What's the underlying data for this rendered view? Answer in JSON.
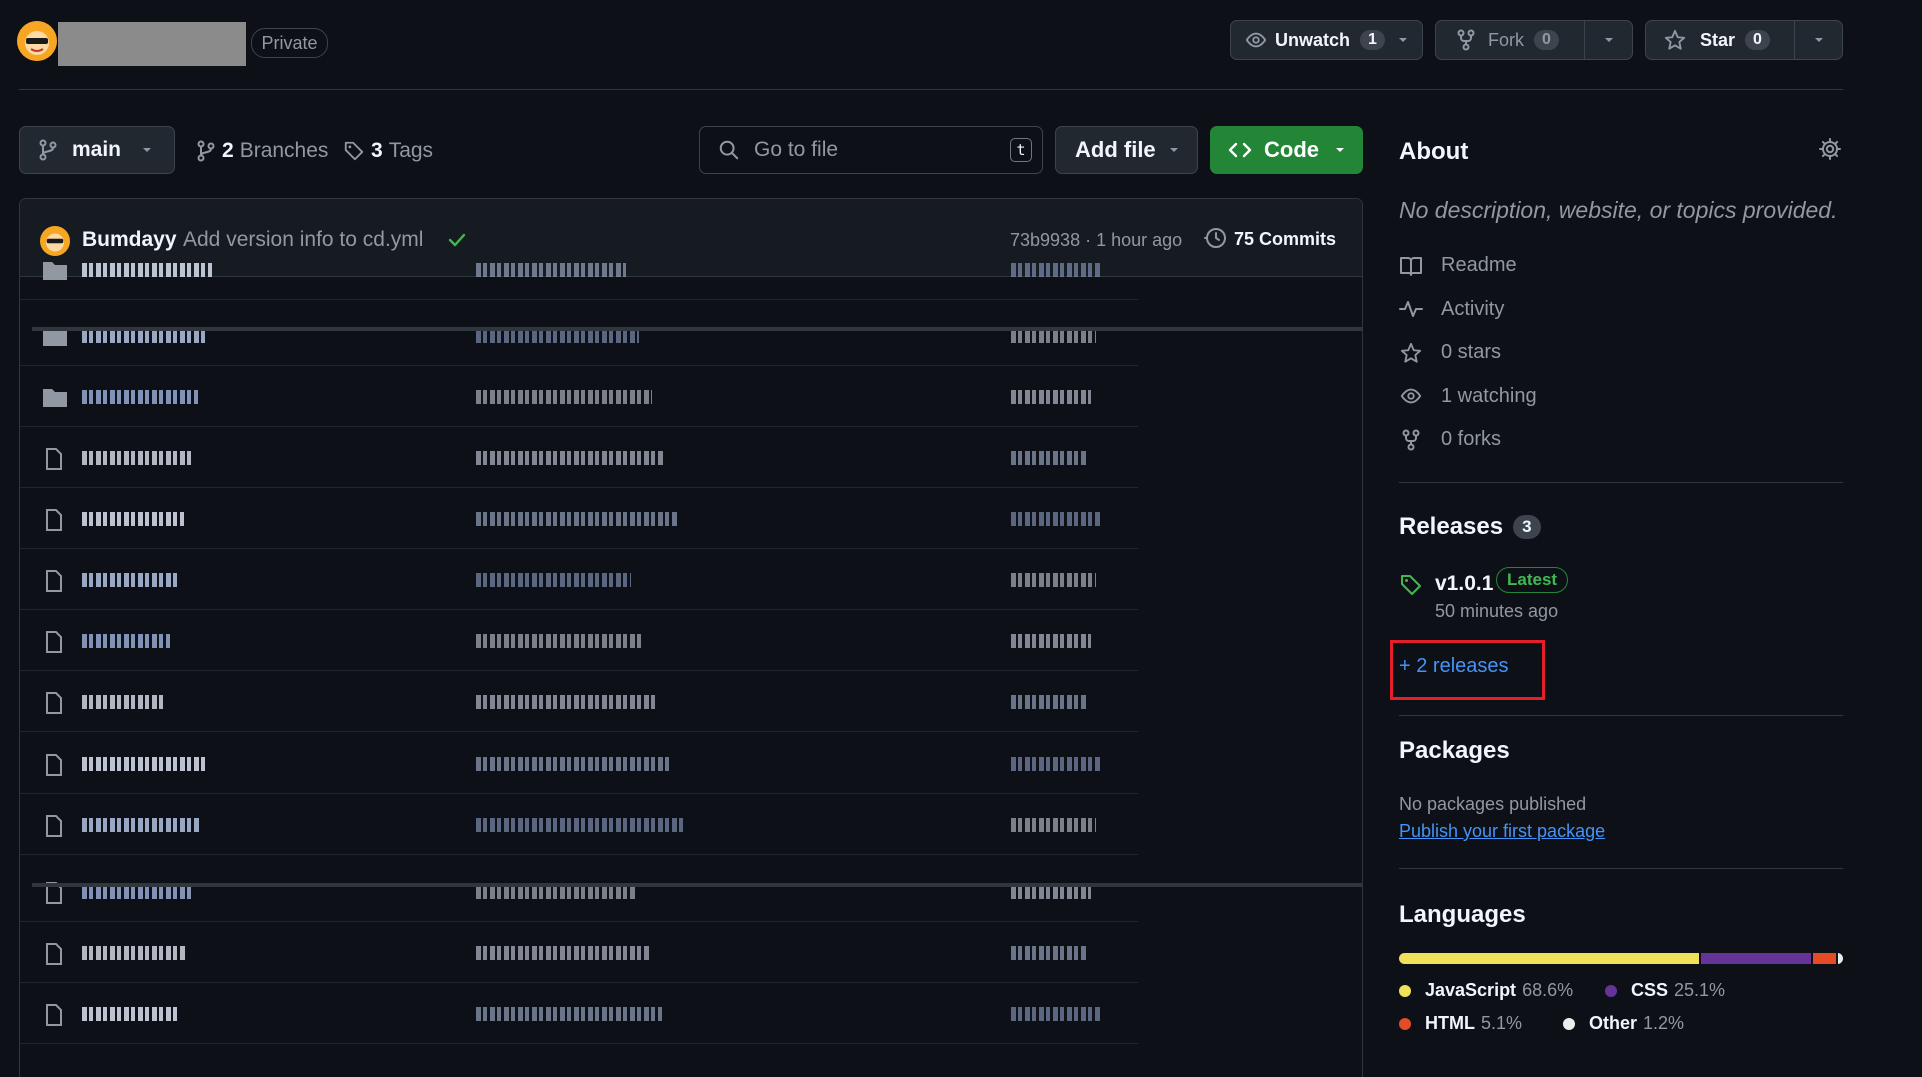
{
  "header": {
    "visibility_badge": "Private",
    "unwatch": {
      "label": "Unwatch",
      "count": "1"
    },
    "fork": {
      "label": "Fork",
      "count": "0"
    },
    "star": {
      "label": "Star",
      "count": "0"
    }
  },
  "toolbar": {
    "branch": "main",
    "branches_count": "2",
    "branches_label": "Branches",
    "tags_count": "3",
    "tags_label": "Tags",
    "search_placeholder": "Go to file",
    "search_shortcut": "t",
    "add_file": "Add file",
    "code": "Code"
  },
  "commit": {
    "author": "Bumdayy",
    "message": "Add version info to cd.yml",
    "hash_time": "73b9938 · 1 hour ago",
    "commits_label": "75 Commits"
  },
  "files": [
    {
      "type": "folder"
    },
    {
      "type": "folder"
    },
    {
      "type": "folder"
    },
    {
      "type": "file"
    },
    {
      "type": "file"
    },
    {
      "type": "file"
    },
    {
      "type": "file"
    },
    {
      "type": "file"
    },
    {
      "type": "file"
    },
    {
      "type": "file"
    },
    {
      "type": "file"
    },
    {
      "type": "file"
    },
    {
      "type": "file"
    }
  ],
  "sidebar": {
    "about_title": "About",
    "about_description": "No description, website, or topics provided.",
    "items": [
      {
        "icon": "book-icon",
        "label": "Readme"
      },
      {
        "icon": "pulse-icon",
        "label": "Activity"
      },
      {
        "icon": "star-icon",
        "label": "0 stars"
      },
      {
        "icon": "eye-icon",
        "label": "1 watching"
      },
      {
        "icon": "fork-icon",
        "label": "0 forks"
      }
    ],
    "releases_title": "Releases",
    "releases_count": "3",
    "latest_release": {
      "version": "v1.0.1",
      "badge": "Latest",
      "time": "50 minutes ago"
    },
    "more_releases": "+ 2 releases",
    "packages_title": "Packages",
    "packages_empty": "No packages published",
    "packages_link": "Publish your first package",
    "languages_title": "Languages",
    "languages": [
      {
        "name": "JavaScript",
        "percent": "68.6%",
        "value": 68.6,
        "color": "#f1e05a"
      },
      {
        "name": "CSS",
        "percent": "25.1%",
        "value": 25.1,
        "color": "#663399"
      },
      {
        "name": "HTML",
        "percent": "5.1%",
        "value": 5.1,
        "color": "#e34c26"
      },
      {
        "name": "Other",
        "percent": "1.2%",
        "value": 1.2,
        "color": "#ededed"
      }
    ]
  },
  "colors": {
    "highlight_box": "#e5202a",
    "link": "#4493f8",
    "accent_green": "#238636"
  }
}
